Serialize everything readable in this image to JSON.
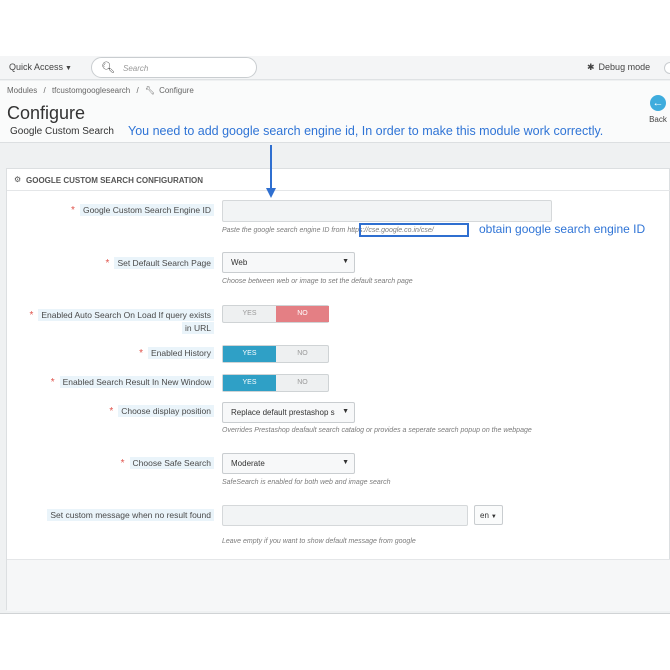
{
  "topbar": {
    "quick_access": "Quick Access",
    "search_placeholder": "Search",
    "debug_mode": "Debug mode"
  },
  "breadcrumb": {
    "item1": "Modules",
    "sep": "/",
    "item2": "tfcustomgooglesearch",
    "item3": "Configure"
  },
  "header": {
    "title": "Configure",
    "subtitle": "Google Custom Search",
    "back_label": "Back"
  },
  "panel": {
    "heading": "GOOGLE CUSTOM SEARCH CONFIGURATION"
  },
  "form": {
    "engine_id": {
      "label": "Google Custom Search Engine ID",
      "help": "Paste the google search engine ID from",
      "help_url": "https://cse.google.co.in/cse/"
    },
    "default_page": {
      "label": "Set Default Search Page",
      "value": "Web",
      "help": "Choose between web or image to set the default search page"
    },
    "auto_search": {
      "label_line1": "Enabled Auto Search On Load If query exists",
      "label_line2": "in URL",
      "yes": "YES",
      "no": "NO",
      "selected": "NO"
    },
    "history": {
      "label": "Enabled History",
      "yes": "YES",
      "no": "NO",
      "selected": "YES"
    },
    "new_window": {
      "label": "Enabled Search Result In New Window",
      "yes": "YES",
      "no": "NO",
      "selected": "YES"
    },
    "display_position": {
      "label": "Choose display position",
      "value": "Replace default prestashop s",
      "help": "Overrides Prestashop deafault search catalog or provides a seperate search popup on the webpage"
    },
    "safe_search": {
      "label": "Choose Safe Search",
      "value": "Moderate",
      "help": "SafeSearch is enabled for both web and image search"
    },
    "custom_message": {
      "label": "Set custom message when no result found",
      "lang": "en",
      "help": "Leave empty if you want to show default message from google"
    },
    "required_mark": "*"
  },
  "annotations": {
    "top_note": "You need to add google search engine id, In order to make this module work correctly.",
    "obtain_note": "obtain google search engine ID",
    "color": "#2f74d6"
  },
  "icons": [
    "search-icon",
    "bug-icon",
    "wrench-icon",
    "back-arrow-icon",
    "cogs-icon",
    "caret-down-icon"
  ]
}
